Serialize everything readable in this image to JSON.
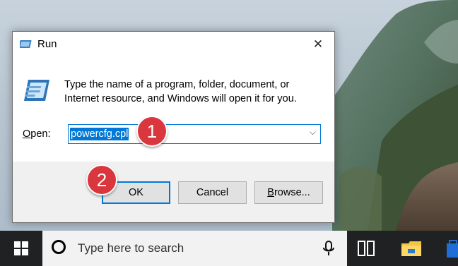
{
  "dialog": {
    "title": "Run",
    "description": "Type the name of a program, folder, document, or Internet resource, and Windows will open it for you.",
    "open_label_prefix": "",
    "open_label_accel": "O",
    "open_label_rest": "pen:",
    "open_value": "powercfg.cpl",
    "buttons": {
      "ok": "OK",
      "cancel": "Cancel",
      "browse_accel": "B",
      "browse_rest": "rowse..."
    }
  },
  "badges": {
    "step1": "1",
    "step2": "2"
  },
  "taskbar": {
    "search_placeholder": "Type here to search"
  },
  "colors": {
    "accent": "#0078d7",
    "badge": "#d9363e",
    "taskbar": "#1f2123"
  },
  "icons": [
    "run-icon",
    "close-icon",
    "run-program-icon",
    "dropdown-arrow-icon",
    "windows-start-icon",
    "cortana-icon",
    "microphone-icon",
    "task-view-icon",
    "file-explorer-icon",
    "store-icon"
  ]
}
